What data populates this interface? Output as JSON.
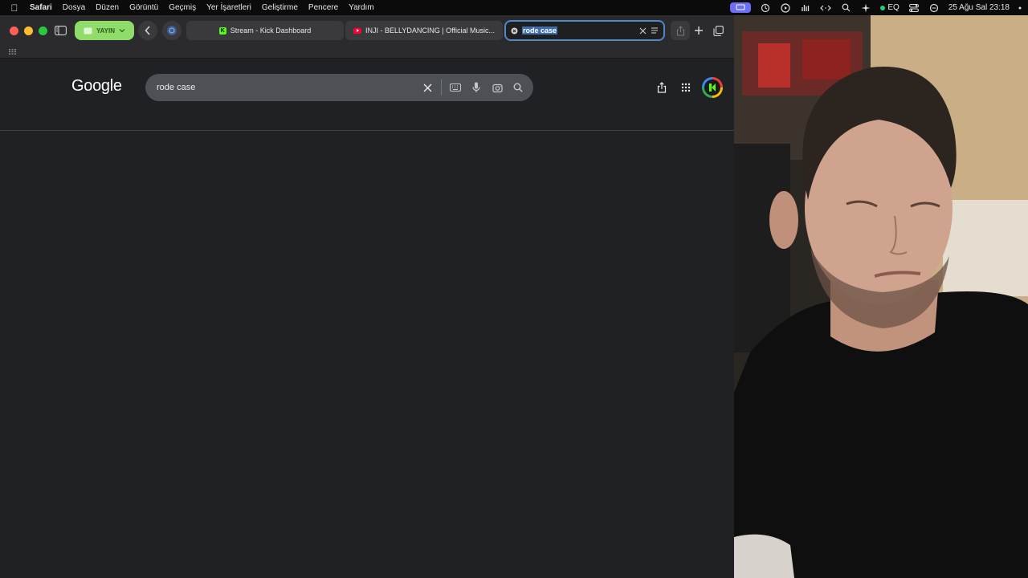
{
  "menubar": {
    "app_name": "Safari",
    "menus": [
      "Dosya",
      "Düzen",
      "Görüntü",
      "Geçmiş",
      "Yer İşaretleri",
      "Geliştirme",
      "Pencere",
      "Yardım"
    ],
    "eq_label": "EQ",
    "datetime": "25 Ağu Sal  23:18"
  },
  "browser": {
    "profile_label": "YAYIN",
    "tabs": [
      {
        "title": "Stream - Kick Dashboard",
        "favicon": "kick-icon"
      },
      {
        "title": "INJI - BELLYDANCING | Official Music...",
        "favicon": "youtube-icon"
      }
    ],
    "active_tab": {
      "url_text": "rode case"
    }
  },
  "google": {
    "logo_text": "Google",
    "query": "rode case"
  },
  "colors": {
    "accent": "#4f89c7",
    "profile_green": "#8fdc6b",
    "page_bg": "#202124",
    "search_bg": "#4d5156"
  }
}
